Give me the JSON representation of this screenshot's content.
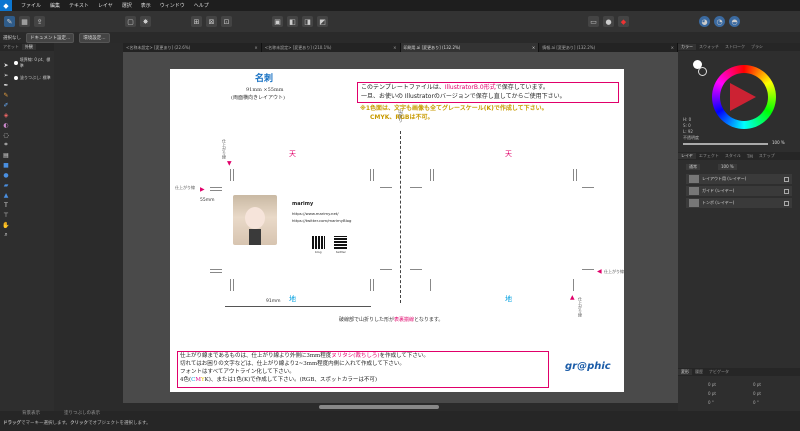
{
  "menu": {
    "items": [
      "ファイル",
      "編集",
      "テキスト",
      "レイヤ",
      "選択",
      "表示",
      "ウィンドウ",
      "ヘルプ"
    ]
  },
  "context": {
    "label": "選択なし",
    "doc_settings": "ドキュメント設定...",
    "env_settings": "環境設定..."
  },
  "tabs": [
    {
      "label": "<名称未設定> [変更あり] (22.6%)",
      "close": "×"
    },
    {
      "label": "<名称未設定> [変更あり] (210.1%)",
      "close": "×"
    },
    {
      "label": "印刷用.ai [変更あり] (132.2%)",
      "close": "×"
    },
    {
      "label": "情報.ai [変更あり] (132.2%)",
      "close": "×"
    }
  ],
  "left_panel": {
    "tabs": [
      "アセット",
      "外観"
    ],
    "row1": "境界線: 0 pt、標準",
    "row2": "塗りつぶし: 標準"
  },
  "document": {
    "title": "名刺",
    "size": "91mm ×55mm",
    "orientation": "(両面横向きレイアウト)",
    "notice1": "このテンプレートファイルは、IllustratorB.0形式で保存しています。",
    "notice1_pre": "このテンプレートファイルは、",
    "notice1_red": "IllustratorB.0形式",
    "notice1_post": "で保存しています。",
    "notice2": "一旦、お使いの Illustratorのバージョンで保存し直してからご使用下さい。",
    "gold1": "※1色面は、文字も画像も全てグレースケール(K)で作成して下さい。",
    "gold2": "CMYK、RGBは不可。",
    "ten": "天",
    "chi": "地",
    "fold_label": "山折り",
    "dim_55": "55mm",
    "dim_91": "91mm",
    "finish_line": "仕上がり線",
    "name": "marimy",
    "url1": "https://www.marimy.net/",
    "url2": "https://twitter.com/marimyBlog",
    "qr1": "blog",
    "qr2": "twitter",
    "fold_note_pre": "破線部で山折りした形が",
    "fold_note_red": "表裏揃線",
    "fold_note_post": "となります。",
    "box1": "仕上がり線まであるものは、仕上がり線より外側に3mm程度ヌリタシ(裁ちしろ)を作成して下さい。",
    "box1_pre": "仕上がり線まであるものは、仕上がり線より外側に3mm程度",
    "box1_red": "ヌリタシ(裁ちしろ)",
    "box1_post": "を作成して下さい。",
    "box2": "切れてはお困りの文字などは、仕上がり線より2~3mm程度内側に入れて作成して下さい。",
    "box3": "フォントはすべてアウトライン化して下さい。",
    "box4_pre": "4色(",
    "box4_c": "C",
    "box4_m": "M",
    "box4_y": "Y",
    "box4_k": "K",
    "box4_post": ")、または1色(K)で作成して下さい。(RGB、スポットカラーは不可)",
    "logo": "gr@phic"
  },
  "right_panel": {
    "tabs": [
      "カラー",
      "スウォッチ",
      "ストローク",
      "ブラシ"
    ],
    "opacity_label": "不透明度",
    "opacity": "100 %",
    "h": "H: 0",
    "s": "S: 0",
    "l": "L: 92",
    "layer_tabs": [
      "レイヤ",
      "エフェクト",
      "スタイル",
      "TM",
      "スナップ"
    ],
    "blend": "通常",
    "opacity2": "100 %",
    "layers": [
      "レイアウト用 (レイヤー)",
      "ガイド (レイヤー)",
      "トンボ (レイヤー)"
    ],
    "transform_tabs": [
      "変形",
      "履歴",
      "ナビゲータ"
    ],
    "fields": [
      "0 pt",
      "0 pt",
      "0 pt",
      "0 pt",
      "0 °",
      "0 °"
    ]
  },
  "status": {
    "hint_bold": "ドラッグ",
    "hint1": "でマーキー選択します。",
    "hint_bold2": "クリック",
    "hint2": "でオブジェクトを選択します。",
    "bottom_left": "背景表示",
    "bottom_mid": "塗りつぶしの表示"
  },
  "colors": {
    "accent": "#1a73c4",
    "red": "#e0006a",
    "gold": "#c89a00",
    "cyan": "#00a0e0",
    "magenta": "#e0008a",
    "yellow": "#e8c800",
    "logo": "#1b5ca8"
  }
}
